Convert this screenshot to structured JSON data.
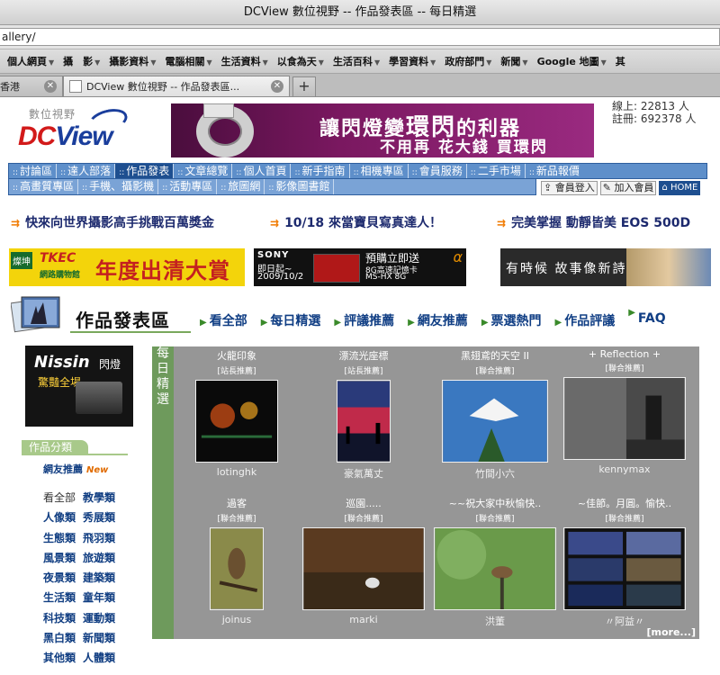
{
  "window": {
    "title": "DCView 數位視野 -- 作品發表區 -- 每日精選"
  },
  "url": {
    "text": "allery/"
  },
  "bookmarks": [
    "個人網頁",
    "攝　影",
    "攝影資料",
    "電腦相關",
    "生活資料",
    "以食為天",
    "生活百科",
    "學習資料",
    "政府部門",
    "新聞",
    "Google 地圖",
    "其"
  ],
  "tabs": [
    {
      "label": "香港"
    },
    {
      "label": "DCView 數位視野 -- 作品發表區..."
    }
  ],
  "site": {
    "logo_small": "數位視野",
    "logo_dc": "DC",
    "logo_view": "View",
    "stats": {
      "online": "線上: 22813 人",
      "registered": "註冊: 692378 人"
    }
  },
  "banner": {
    "line1a": "讓閃燈變",
    "line1b": "環閃",
    "line1c": "的利器",
    "line2": "不用再 花大錢 買環閃"
  },
  "nav": {
    "row1": [
      "討論區",
      "達人部落",
      "作品發表",
      "文章總覽",
      "個人首頁",
      "新手指南",
      "相機專區",
      "會員服務",
      "二手市場",
      "新品報價"
    ],
    "row2": [
      "高畫質專區",
      "手機、攝影機",
      "活動專區",
      "旅圖網",
      "影像圖書館"
    ],
    "login": "會員登入",
    "join": "加入會員",
    "home": "HOME"
  },
  "promo": [
    "快來向世界攝影高手挑戰百萬獎金",
    "10/18 來當寶貝寫真達人！",
    "完美掌握 動靜皆美 EOS 500D"
  ],
  "ads": {
    "tkec": {
      "badge": "燦坤",
      "brand": "TKEC",
      "sub": "網路購物館",
      "headline": "年度出清大賞"
    },
    "sony": {
      "brand": "SONY",
      "date1": "即日起~",
      "date2": "2009/10/2",
      "buy": "預購立即送",
      "gift1": "8G高速記憶卡",
      "gift2": "MS-HX 8G",
      "alpha": "α"
    },
    "family": {
      "text": "有時候 故事像新詩"
    }
  },
  "section": {
    "title": "作品發表區",
    "links": [
      "看全部",
      "每日精選",
      "評議推薦",
      "網友推薦",
      "票選熱門",
      "作品評議",
      "FAQ"
    ]
  },
  "nissin": {
    "brand": "Nissin",
    "brand2": "閃燈",
    "sub": "驚豔全場"
  },
  "categories": {
    "header": "作品分類",
    "new_label": "網友推薦",
    "new_badge": "New",
    "rows": [
      [
        "看全部",
        "教學類"
      ],
      [
        "人像類",
        "秀展類"
      ],
      [
        "生態類",
        "飛羽類"
      ],
      [
        "風景類",
        "旅遊類"
      ],
      [
        "夜景類",
        "建築類"
      ],
      [
        "生活類",
        "童年類"
      ],
      [
        "科技類",
        "運動類"
      ],
      [
        "黑白類",
        "新聞類"
      ],
      [
        "其他類",
        "人體類"
      ]
    ]
  },
  "gallery": {
    "label": "每日精選",
    "more": "[more...]",
    "items": [
      {
        "title": "火龍印象",
        "tag": "[站長推薦]",
        "author": "lotinghk"
      },
      {
        "title": "漂流光座標",
        "tag": "[站長推薦]",
        "author": "豪氣萬丈"
      },
      {
        "title": "黑翅鳶的天空 II",
        "tag": "[聯合推薦]",
        "author": "竹間小六"
      },
      {
        "title": "+ Reflection +",
        "tag": "[聯合推薦]",
        "author": "kennymax"
      },
      {
        "title": "過客",
        "tag": "[聯合推薦]",
        "author": "joinus"
      },
      {
        "title": "巡園.....",
        "tag": "[聯合推薦]",
        "author": "marki"
      },
      {
        "title": "~~祝大家中秋愉快..",
        "tag": "[聯合推薦]",
        "author": "洪董"
      },
      {
        "title": "~佳節。月圓。愉快..",
        "tag": "[聯合推薦]",
        "author": "〃阿益〃"
      }
    ]
  }
}
